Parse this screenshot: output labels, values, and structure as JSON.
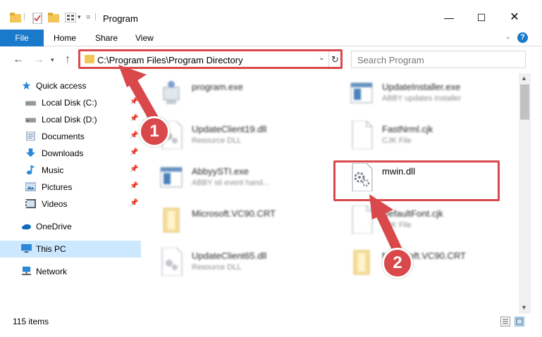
{
  "window": {
    "title": "Program"
  },
  "ribbon": {
    "file": "File",
    "home": "Home",
    "share": "Share",
    "view": "View",
    "help": "?"
  },
  "address": {
    "path": "C:\\Program Files\\Program Directory"
  },
  "search": {
    "placeholder": "Search Program"
  },
  "nav": {
    "items": [
      {
        "label": "Quick access",
        "icon": "star-icon"
      },
      {
        "label": "Local Disk (C:)",
        "icon": "drive-icon",
        "pinned": true
      },
      {
        "label": "Local Disk (D:)",
        "icon": "drive-icon",
        "pinned": true
      },
      {
        "label": "Documents",
        "icon": "documents-icon",
        "pinned": true
      },
      {
        "label": "Downloads",
        "icon": "download-icon",
        "pinned": true
      },
      {
        "label": "Music",
        "icon": "music-icon",
        "pinned": true
      },
      {
        "label": "Pictures",
        "icon": "pictures-icon",
        "pinned": true
      },
      {
        "label": "Videos",
        "icon": "videos-icon",
        "pinned": true
      },
      {
        "label": "OneDrive",
        "icon": "cloud-icon"
      },
      {
        "label": "This PC",
        "icon": "computer-icon",
        "selected": true
      },
      {
        "label": "Network",
        "icon": "network-icon"
      }
    ]
  },
  "files": [
    {
      "name": "program.exe",
      "desc": ""
    },
    {
      "name": "UpdateInstaller.exe",
      "desc": "ABBY updates installer"
    },
    {
      "name": "UpdateClient19.dll",
      "desc": "Resource DLL"
    },
    {
      "name": "FastNrml.cjk",
      "desc": "CJK File"
    },
    {
      "name": "AbbyySTI.exe",
      "desc": "ABBY sti event hand..."
    },
    {
      "name": "mwin.dll",
      "desc": ""
    },
    {
      "name": "Microsoft.VC90.CRT",
      "desc": ""
    },
    {
      "name": "DefaultFont.cjk",
      "desc": "CJK File"
    },
    {
      "name": "UpdateClient65.dll",
      "desc": "Resource DLL"
    },
    {
      "name": "Microsoft.VC90.CRT",
      "desc": ""
    }
  ],
  "status": {
    "count": "115 items"
  },
  "callouts": {
    "one": "1",
    "two": "2"
  },
  "colors": {
    "accent": "#1979ca",
    "highlight": "#d9484a",
    "selected": "#cce8ff"
  }
}
